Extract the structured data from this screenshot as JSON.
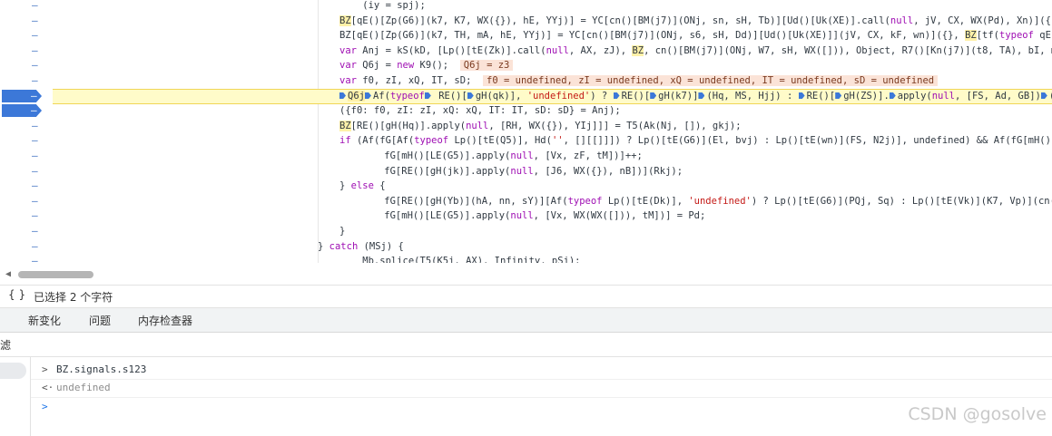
{
  "editor": {
    "lines": [
      {
        "type": "plain",
        "text": "    (iy = spj);"
      },
      {
        "type": "mixed",
        "parts": [
          [
            "hl",
            "BZ"
          ],
          [
            "",
            "[qE()[Zp(G6)](k7, K7, WX({}), hE, YYj)] = YC[cn()[BM(j7)](ONj, sn, sH, Tb)][Ud()[Uk(XE)].call("
          ],
          [
            "kw",
            "null"
          ],
          [
            "",
            ", jV, CX, WX(Pd), Xn)]({}, "
          ],
          [
            "hl",
            "BZ"
          ],
          [
            "",
            "[qE"
          ]
        ]
      },
      {
        "type": "mixed",
        "parts": [
          [
            "",
            "BZ[qE()[Zp(G6)](k7, TH, mA, hE, YYj)] = YC[cn()[BM(j7)](ONj, s6, sH, Dd)][Ud()[Uk(XE)]](jV, CX, kF, wn)]({}, "
          ],
          [
            "hl",
            "BZ"
          ],
          [
            "",
            "[tf("
          ],
          [
            "kw",
            "typeof"
          ],
          [
            "",
            " qE()[Zp(AX)"
          ]
        ]
      },
      {
        "type": "mixed",
        "parts": [
          [
            "kw",
            "var"
          ],
          [
            "",
            " Anj = kS(kD, [Lp()[tE(Zk)].call("
          ],
          [
            "kw",
            "null"
          ],
          [
            "",
            ", AX, zJ), "
          ],
          [
            "hl",
            "BZ"
          ],
          [
            "",
            ", cn()[BM(j7)](ONj, W7, sH, WX([])), Object, R7()[Kn(j7)](t8, TA), bI, mH()[LE"
          ]
        ]
      },
      {
        "type": "mixed",
        "parts": [
          [
            "kw",
            "var"
          ],
          [
            "",
            " Q6j = "
          ],
          [
            "kw",
            "new"
          ],
          [
            "",
            " K9();  "
          ],
          [
            "val",
            "Q6j = z3"
          ]
        ]
      },
      {
        "type": "mixed",
        "parts": [
          [
            "kw",
            "var"
          ],
          [
            "",
            " f0, zI, xQ, IT, sD;  "
          ],
          [
            "val",
            "f0 = undefined, zI = undefined, xQ = undefined, IT = undefined, sD = undefined"
          ]
        ]
      },
      {
        "type": "exec",
        "parts": [
          [
            "mark",
            ""
          ],
          [
            "hl",
            "Q6j"
          ],
          [
            "mark",
            ""
          ],
          [
            "",
            "Af("
          ],
          [
            "kw",
            "typeof"
          ],
          [
            "mark",
            ""
          ],
          [
            "",
            " RE()["
          ],
          [
            "mark",
            ""
          ],
          [
            "",
            "gH(qk)], "
          ],
          [
            "str",
            "'undefined'"
          ],
          [
            "",
            ") ? "
          ],
          [
            "mark",
            ""
          ],
          [
            "",
            "RE()["
          ],
          [
            "mark",
            ""
          ],
          [
            "",
            "gH(k7)]"
          ],
          [
            "mark",
            ""
          ],
          [
            "",
            "(Hq, MS, Hjj) : "
          ],
          [
            "mark",
            ""
          ],
          [
            "",
            "RE()["
          ],
          [
            "mark",
            ""
          ],
          [
            "",
            "gH(ZS)]."
          ],
          [
            "mark",
            ""
          ],
          [
            "",
            "apply("
          ],
          [
            "kw",
            "null"
          ],
          [
            "",
            ", [FS, Ad, GB])"
          ],
          [
            "mark",
            ""
          ],
          [
            "",
            "(Anj"
          ]
        ]
      },
      {
        "type": "mixed",
        "parts": [
          [
            "",
            "({f0: f0, zI: zI, xQ: xQ, IT: IT, sD: sD} = Anj);"
          ]
        ]
      },
      {
        "type": "mixed",
        "parts": [
          [
            "hl",
            "BZ"
          ],
          [
            "",
            "[RE()[gH(Hq)].apply("
          ],
          [
            "kw",
            "null"
          ],
          [
            "",
            ", [RH, WX({}), YIj]]] = T5(Ak(Nj, []), gkj);"
          ]
        ]
      },
      {
        "type": "mixed",
        "parts": [
          [
            "kw",
            "if"
          ],
          [
            "",
            " (Af(fG[Af("
          ],
          [
            "kw",
            "typeof"
          ],
          [
            "",
            " Lp()[tE(Q5)], Hd("
          ],
          [
            "str",
            "''"
          ],
          [
            "",
            ", [][[]]]) ? Lp()[tE(G6)](El, bvj) : Lp()[tE(wn)](FS, N2j)], undefined) && Af(fG[mH()[LE(G5)]"
          ]
        ]
      },
      {
        "type": "mixed",
        "parts": [
          [
            "",
            "    fG[mH()[LE(G5)].apply("
          ],
          [
            "kw",
            "null"
          ],
          [
            "",
            ", [Vx, zF, tM])]++;"
          ]
        ]
      },
      {
        "type": "mixed",
        "parts": [
          [
            "",
            "    fG[RE()[gH(jk)].apply("
          ],
          [
            "kw",
            "null"
          ],
          [
            "",
            ", [J6, WX({}), nB])](Rkj);"
          ]
        ]
      },
      {
        "type": "mixed",
        "parts": [
          [
            "",
            "} "
          ],
          [
            "kw",
            "else"
          ],
          [
            "",
            " {"
          ]
        ]
      },
      {
        "type": "mixed",
        "parts": [
          [
            "",
            "    fG[RE()[gH(Yb)](hA, nn, sY)][Af("
          ],
          [
            "kw",
            "typeof"
          ],
          [
            "",
            " Lp()[tE(Dk)], "
          ],
          [
            "str",
            "'undefined'"
          ],
          [
            "",
            ") ? Lp()[tE(G6)](PQj, Sq) : Lp()[tE(Vk)](K7, Vp)](cn()[BM(Cp)]("
          ]
        ]
      },
      {
        "type": "mixed",
        "parts": [
          [
            "",
            "    fG[mH()[LE(G5)].apply("
          ],
          [
            "kw",
            "null"
          ],
          [
            "",
            ", [Vx, WX(WX([])), tM])] = Pd;"
          ]
        ]
      },
      {
        "type": "mixed",
        "parts": [
          [
            "",
            "}"
          ]
        ]
      },
      {
        "type": "mixed",
        "parts": [
          [
            "",
            "} "
          ],
          [
            "kw",
            "catch"
          ],
          [
            "",
            " (MSj) {"
          ]
        ]
      },
      {
        "type": "mixed",
        "parts": [
          [
            "",
            "    Mb.splice(T5(K5j, AX), Infinity, pSj);"
          ]
        ]
      }
    ],
    "gutter_mark": "–"
  },
  "status": {
    "braces": "{ }",
    "selection_text": "已选择 2 个字符"
  },
  "drawer_tabs": [
    "新变化",
    "问题",
    "内存检查器"
  ],
  "filter": {
    "label": "滤"
  },
  "console": {
    "input_expr": "BZ.signals.s123",
    "result": "undefined",
    "input_prefix": ">",
    "result_prefix": "<·",
    "prompt_prefix": ">"
  },
  "watermark": "CSDN @gosolve"
}
